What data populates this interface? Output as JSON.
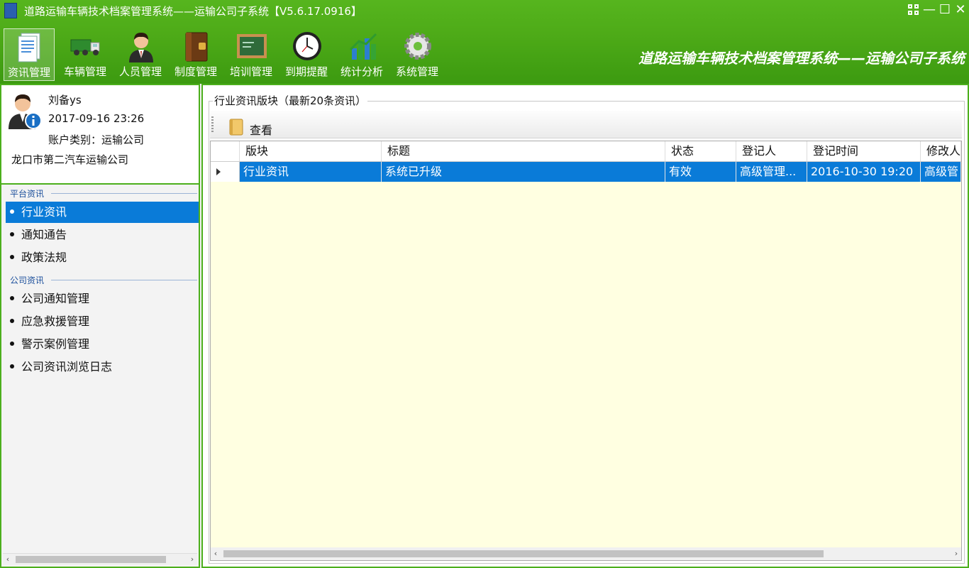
{
  "window": {
    "title": "道路运输车辆技术档案管理系统——运输公司子系统【V5.6.17.0916】",
    "controls": {
      "minimize": "—",
      "maximize": "☐",
      "close": "✕"
    }
  },
  "toolbar": [
    {
      "label": "资讯管理",
      "icon": "news-document-icon",
      "active": true
    },
    {
      "label": "车辆管理",
      "icon": "truck-icon"
    },
    {
      "label": "人员管理",
      "icon": "person-icon"
    },
    {
      "label": "制度管理",
      "icon": "binder-icon"
    },
    {
      "label": "培训管理",
      "icon": "chalkboard-icon"
    },
    {
      "label": "到期提醒",
      "icon": "clock-icon"
    },
    {
      "label": "统计分析",
      "icon": "bar-chart-icon"
    },
    {
      "label": "系统管理",
      "icon": "gear-icon"
    }
  ],
  "brand": "道路运输车辆技术档案管理系统——运输公司子系统",
  "user": {
    "name": "刘备ys",
    "datetime": "2017-09-16 23:26",
    "account_type": "账户类别：运输公司",
    "company": "龙口市第二汽车运输公司"
  },
  "sidebar": {
    "groups": [
      {
        "title": "平台资讯",
        "items": [
          "行业资讯",
          "通知通告",
          "政策法规"
        ]
      },
      {
        "title": "公司资讯",
        "items": [
          "公司通知管理",
          "应急救援管理",
          "警示案例管理",
          "公司资讯浏览日志"
        ]
      }
    ],
    "selected": "行业资讯"
  },
  "main": {
    "section_title": "行业资讯版块（最新20条资讯）",
    "view_button": "查看",
    "columns": [
      "版块",
      "标题",
      "状态",
      "登记人",
      "登记时间",
      "修改人"
    ],
    "rows": [
      [
        "行业资讯",
        "系统已升级",
        "有效",
        "高级管理...",
        "2016-10-30 19:20",
        "高级管"
      ]
    ]
  },
  "colors": {
    "green_bar": "#4eab18",
    "selection": "#0a7bd8",
    "grid_background": "#ffffe1"
  }
}
